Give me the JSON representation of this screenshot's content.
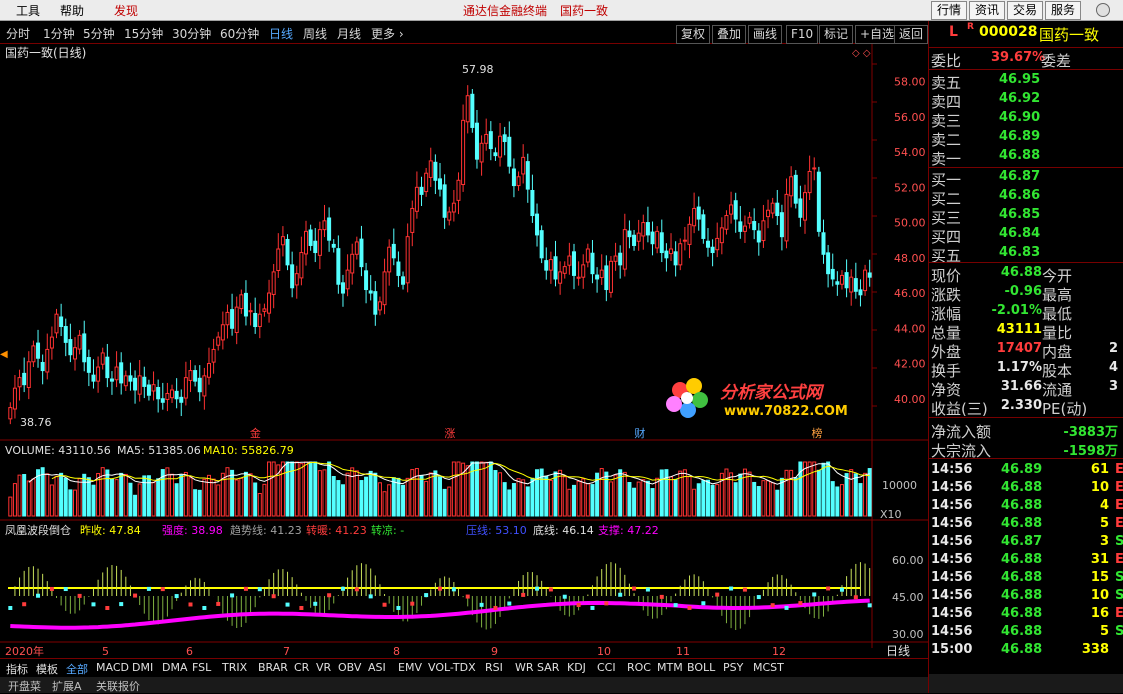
{
  "menu": {
    "tools": "工具",
    "help": "帮助",
    "discover": "发现",
    "center_app": "通达信金融终端",
    "center_stock": "国药一致",
    "buttons": [
      "行情",
      "资讯",
      "交易",
      "服务"
    ]
  },
  "periods": [
    "分时",
    "1分钟",
    "5分钟",
    "15分钟",
    "30分钟",
    "60分钟",
    "日线",
    "周线",
    "月线",
    "更多 ›"
  ],
  "active_period": "日线",
  "toolbar": [
    "复权",
    "叠加",
    "画线",
    "F10",
    "标记",
    "+自选",
    "返回"
  ],
  "chart": {
    "title": "国药一致(日线)",
    "high_label": "57.98",
    "low_label": "38.76",
    "price_ticks": [
      "58.00",
      "56.00",
      "54.00",
      "52.00",
      "50.00",
      "48.00",
      "46.00",
      "44.00",
      "42.00",
      "40.00"
    ],
    "markers": [
      {
        "t": "金",
        "c": "#ff3c3c"
      },
      {
        "t": "涨",
        "c": "#ff3c3c"
      },
      {
        "t": "财",
        "c": "#56a9ff"
      },
      {
        "t": "榜",
        "c": "#ffa040"
      }
    ],
    "volume_info": {
      "vol": "VOLUME: 43110.56",
      "ma5": "MA5: 51385.06",
      "ma10": "MA10: 55826.79"
    },
    "volume_tick": "10000",
    "volume_unit": "X10",
    "indicator_info": {
      "name": "凤凰波段倒仓",
      "prev": "昨收: 47.84",
      "strong": "强度: 38.98",
      "trend": "趋势线: 41.23",
      "warm": "转暖: 41.23",
      "cold": "转凉: -",
      "pressure": "压线: 53.10",
      "bottom": "底线: 46.14",
      "support": "支撑: 47.22"
    },
    "ind_ticks": [
      "60.00",
      "45.00",
      "30.00"
    ],
    "x_labels": [
      "2020年",
      "5",
      "6",
      "7",
      "8",
      "9",
      "10",
      "11",
      "12"
    ],
    "period_label": "日线"
  },
  "chart_data": {
    "type": "candlestick",
    "ylim": [
      38,
      59
    ],
    "closes": [
      39.5,
      40.6,
      41.2,
      40.8,
      42.1,
      43.0,
      42.3,
      41.6,
      42.8,
      43.5,
      44.8,
      44.1,
      43.2,
      42.5,
      42.9,
      43.6,
      42.1,
      41.5,
      41.0,
      41.8,
      42.6,
      41.2,
      41.0,
      41.8,
      40.9,
      41.3,
      41.0,
      40.5,
      41.3,
      40.7,
      40.2,
      40.8,
      40.0,
      39.8,
      40.3,
      40.5,
      40.0,
      39.8,
      41.2,
      41.6,
      41.0,
      40.4,
      41.3,
      42.0,
      42.8,
      43.5,
      44.2,
      44.9,
      44.0,
      45.2,
      45.9,
      44.7,
      45.0,
      44.1,
      44.8,
      45.1,
      46.0,
      47.2,
      48.5,
      49.2,
      47.6,
      46.3,
      47.1,
      48.3,
      49.5,
      48.7,
      48.3,
      49.6,
      50.1,
      49.0,
      48.6,
      46.5,
      46.0,
      47.3,
      48.2,
      48.9,
      47.5,
      46.2,
      46.0,
      44.8,
      45.5,
      47.2,
      48.6,
      48.0,
      47.0,
      46.5,
      49.2,
      50.8,
      52.0,
      51.6,
      52.8,
      53.5,
      52.4,
      51.9,
      50.3,
      50.6,
      51.1,
      52.4,
      55.8,
      57.2,
      55.4,
      53.6,
      54.5,
      55.0,
      54.2,
      53.8,
      54.9,
      54.6,
      53.2,
      52.1,
      52.6,
      53.7,
      51.9,
      50.4,
      49.3,
      48.0,
      47.3,
      47.9,
      46.8,
      47.2,
      47.5,
      48.1,
      47.0,
      46.9,
      47.6,
      48.5,
      47.1,
      46.8,
      47.3,
      46.2,
      47.8,
      48.1,
      47.6,
      49.6,
      49.2,
      48.7,
      49.4,
      50.0,
      49.3,
      48.8,
      49.5,
      48.3,
      48.0,
      48.5,
      47.6,
      48.8,
      49.0,
      49.9,
      50.8,
      50.2,
      49.1,
      48.6,
      48.3,
      49.1,
      49.7,
      50.4,
      51.0,
      50.2,
      49.5,
      49.8,
      50.3,
      49.6,
      48.9,
      50.1,
      50.7,
      51.1,
      50.4,
      49.2,
      51.6,
      52.6,
      51.1,
      50.3,
      51.7,
      52.9,
      53.1,
      49.5,
      48.2,
      47.1,
      46.8,
      46.5,
      47.0,
      46.3,
      46.9,
      46.1,
      45.9,
      47.3,
      46.9
    ],
    "volume_note": "volume and indicator series drawn relative",
    "last_close": 46.88
  },
  "quote": {
    "code_prefix": "L",
    "code_badge": "R",
    "code": "000028",
    "name": "国药一致",
    "weibi_label": "委比",
    "weibi": "39.67%",
    "weicha_label": "委差",
    "asks": [
      {
        "l": "卖五",
        "p": "46.95"
      },
      {
        "l": "卖四",
        "p": "46.92"
      },
      {
        "l": "卖三",
        "p": "46.90"
      },
      {
        "l": "卖二",
        "p": "46.89"
      },
      {
        "l": "卖一",
        "p": "46.88"
      }
    ],
    "bids": [
      {
        "l": "买一",
        "p": "46.87"
      },
      {
        "l": "买二",
        "p": "46.86"
      },
      {
        "l": "买三",
        "p": "46.85"
      },
      {
        "l": "买四",
        "p": "46.84"
      },
      {
        "l": "买五",
        "p": "46.83"
      }
    ],
    "stats": [
      {
        "l": "现价",
        "v": "46.88",
        "c": "green",
        "r": "今开"
      },
      {
        "l": "涨跌",
        "v": "-0.96",
        "c": "green",
        "r": "最高"
      },
      {
        "l": "涨幅",
        "v": "-2.01%",
        "c": "green",
        "r": "最低"
      },
      {
        "l": "总量",
        "v": "43111",
        "c": "yellow",
        "r": "量比"
      },
      {
        "l": "外盘",
        "v": "17407",
        "c": "red",
        "r": "内盘",
        "rv": "2"
      },
      {
        "l": "换手",
        "v": "1.17%",
        "c": "white",
        "r": "股本",
        "rv": "4"
      },
      {
        "l": "净资",
        "v": "31.66",
        "c": "white",
        "r": "流通",
        "rv": "3"
      },
      {
        "l": "收益(三)",
        "v": "2.330",
        "c": "white",
        "r": "PE(动)"
      }
    ],
    "flows": [
      {
        "l": "净流入额",
        "v": "-3883万"
      },
      {
        "l": "大宗流入",
        "v": "-1598万"
      }
    ],
    "ticks": [
      {
        "t": "14:56",
        "p": "46.89",
        "v": "61",
        "d": "E"
      },
      {
        "t": "14:56",
        "p": "46.88",
        "v": "10",
        "d": "E"
      },
      {
        "t": "14:56",
        "p": "46.88",
        "v": "4",
        "d": "E"
      },
      {
        "t": "14:56",
        "p": "46.88",
        "v": "5",
        "d": "E"
      },
      {
        "t": "14:56",
        "p": "46.87",
        "v": "3",
        "d": "S"
      },
      {
        "t": "14:56",
        "p": "46.88",
        "v": "31",
        "d": "E"
      },
      {
        "t": "14:56",
        "p": "46.88",
        "v": "15",
        "d": "S"
      },
      {
        "t": "14:56",
        "p": "46.88",
        "v": "10",
        "d": "S"
      },
      {
        "t": "14:56",
        "p": "46.88",
        "v": "16",
        "d": "E"
      },
      {
        "t": "14:56",
        "p": "46.88",
        "v": "5",
        "d": "S"
      },
      {
        "t": "15:00",
        "p": "46.88",
        "v": "338",
        "d": ""
      }
    ]
  },
  "indicator_tabs": [
    "指标",
    "模板",
    "全部",
    "MACD",
    "DMI",
    "DMA",
    "FSL",
    "TRIX",
    "BRAR",
    "CR",
    "VR",
    "OBV",
    "ASI",
    "EMV",
    "VOL-TDX",
    "RSI",
    "WR",
    "SAR",
    "KDJ",
    "CCI",
    "ROC",
    "MTM",
    "BOLL",
    "PSY",
    "MCST"
  ],
  "bottom_tabs2": [
    "开盘菜",
    "扩展A",
    "关联报价"
  ],
  "logo": {
    "title": "分析家公式网",
    "url": "www.70822.COM"
  },
  "colors": {
    "up": "#ff3232",
    "down": "#54ffff",
    "bg": "#000000",
    "ma5": "#ffffff",
    "ma10": "#ffff00",
    "magenta": "#ff00ff"
  }
}
